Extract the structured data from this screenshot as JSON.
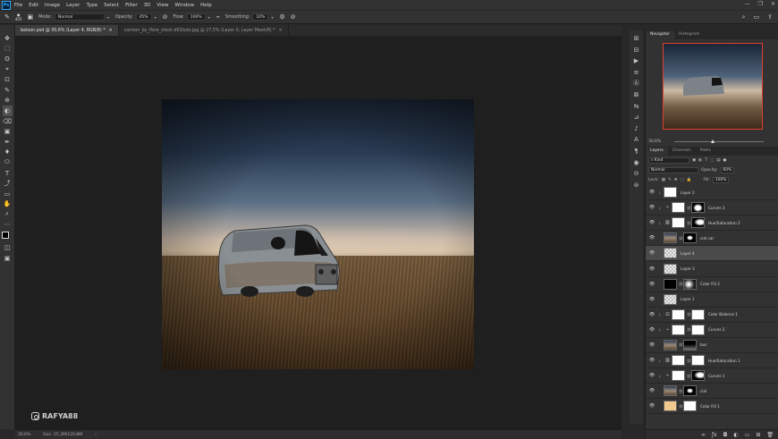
{
  "app": {
    "logo": "Ps"
  },
  "menu": [
    "File",
    "Edit",
    "Image",
    "Layer",
    "Type",
    "Select",
    "Filter",
    "3D",
    "View",
    "Window",
    "Help"
  ],
  "window_controls": [
    "—",
    "❐",
    "✕"
  ],
  "options_bar": {
    "brush_size": "405",
    "mode_label": "Mode:",
    "mode_value": "Normal",
    "opacity_label": "Opacity:",
    "opacity_value": "45%",
    "flow_label": "Flow:",
    "flow_value": "100%",
    "smoothing_label": "Smoothing:",
    "smoothing_value": "10%"
  },
  "tabs": [
    {
      "label": "baloon.psd @ 30,6% (Layer 4, RGB/8) *",
      "close": "×"
    },
    {
      "label": "camion_by_flore_stock-d63isdo.jpg @ 27,5% (Layer 0, Layer Mask/8) *",
      "close": "×"
    }
  ],
  "tools": [
    "✥",
    "⬚",
    "ʘ",
    "⌖",
    "⊡",
    "✎",
    "⊕",
    "◐",
    "⌫",
    "▣",
    "✒",
    "♦",
    "⬭",
    "T",
    "⤴",
    "▭",
    "✋",
    "⌕",
    "⋯"
  ],
  "watermark": "RAFYA88",
  "status": {
    "zoom": "30,6%",
    "doc": "Doc: 15,3M/120,8M",
    "arrow": "›"
  },
  "strip_icons": [
    "⊞",
    "⊟",
    "▶",
    "≡",
    "Ⓐ",
    "⊠",
    "⇆",
    "⊿",
    "♪",
    "A",
    "¶",
    "◉",
    "⊝",
    "⊜"
  ],
  "navigator": {
    "tabs": [
      "Navigator",
      "Histogram"
    ],
    "zoom": "30,6%",
    "zoom_out": "▲",
    "zoom_in": "▲"
  },
  "layers_panel": {
    "tabs": [
      "Layers",
      "Channels",
      "Paths"
    ],
    "kind_label": "Kind",
    "blend_mode": "Normal",
    "opacity_label": "Opacity:",
    "opacity_value": "60%",
    "lock_label": "Lock:",
    "fill_label": "Fill:",
    "fill_value": "100%",
    "layers": [
      {
        "name": "Layer 2",
        "thumb": "t-white",
        "mask": "",
        "adj": "",
        "selected": false,
        "clipped": true
      },
      {
        "name": "Curves 3",
        "thumb": "t-white",
        "mask": "t-blob",
        "adj": "⌁",
        "selected": false,
        "clipped": true
      },
      {
        "name": "Hue/Saturation 2",
        "thumb": "t-white",
        "mask": "t-blob2",
        "adj": "▥",
        "selected": false,
        "clipped": true
      },
      {
        "name": "ciel car",
        "thumb": "t-photo",
        "mask": "t-blackblob",
        "adj": "",
        "selected": false,
        "clipped": false
      },
      {
        "name": "Layer 4",
        "thumb": "t-check",
        "mask": "",
        "adj": "",
        "selected": true,
        "clipped": false
      },
      {
        "name": "Layer 3",
        "thumb": "t-check",
        "mask": "",
        "adj": "",
        "selected": false,
        "clipped": false
      },
      {
        "name": "Color Fill 2",
        "thumb": "t-black",
        "mask": "t-rgrad",
        "adj": "",
        "selected": false,
        "clipped": false
      },
      {
        "name": "Layer 1",
        "thumb": "t-check",
        "mask": "",
        "adj": "",
        "selected": false,
        "clipped": false
      },
      {
        "name": "Color Balance 1",
        "thumb": "t-white",
        "mask": "t-white",
        "adj": "⚖",
        "selected": false,
        "clipped": true
      },
      {
        "name": "Curves 2",
        "thumb": "t-white",
        "mask": "t-white",
        "adj": "⌁",
        "selected": false,
        "clipped": true
      },
      {
        "name": "bus",
        "thumb": "t-photo",
        "mask": "t-dark",
        "adj": "",
        "selected": false,
        "clipped": false
      },
      {
        "name": "Hue/Saturation 1",
        "thumb": "t-white",
        "mask": "t-white",
        "adj": "▥",
        "selected": false,
        "clipped": true
      },
      {
        "name": "Curves 1",
        "thumb": "t-white",
        "mask": "t-blob2",
        "adj": "⌁",
        "selected": false,
        "clipped": true
      },
      {
        "name": "ciel",
        "thumb": "t-photo",
        "mask": "t-blackblob",
        "adj": "",
        "selected": false,
        "clipped": false
      },
      {
        "name": "Color Fill 1",
        "thumb": "t-peach",
        "mask": "t-white",
        "adj": "",
        "selected": false,
        "clipped": false
      }
    ],
    "footer_icons": [
      "ƒx",
      "◘",
      "◐",
      "▭",
      "⊞",
      "🗑"
    ]
  }
}
